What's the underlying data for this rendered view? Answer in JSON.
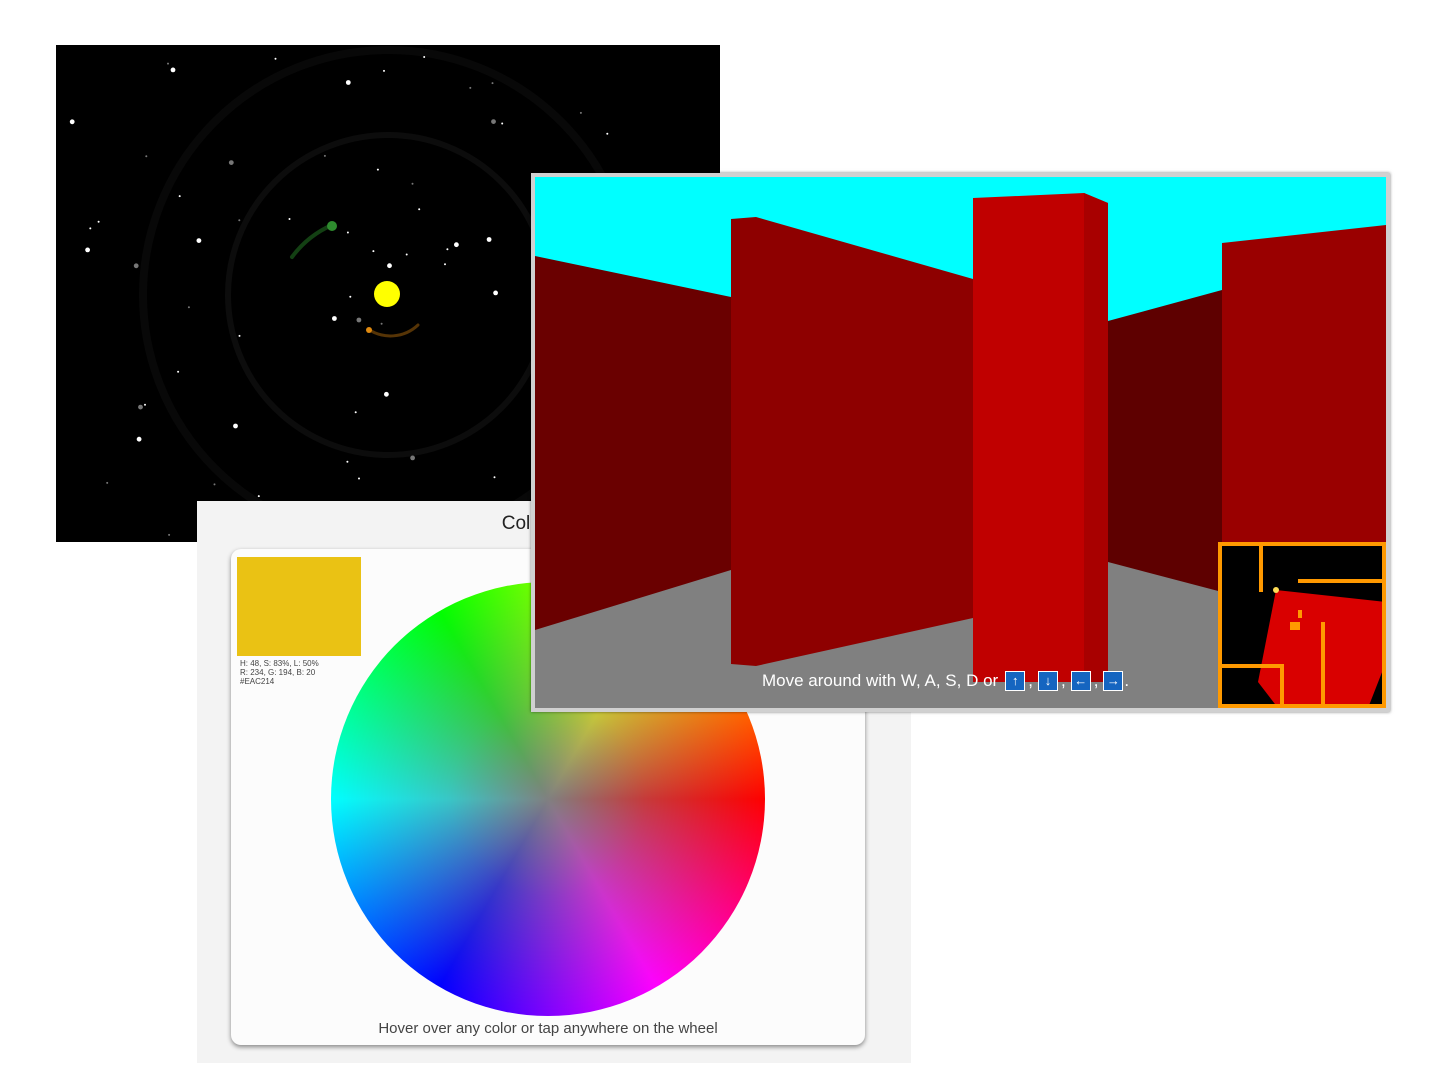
{
  "color_wheel": {
    "title": "Color Wheel",
    "hint": "Hover over any color or tap anywhere on the wheel",
    "selected": {
      "swatch_color": "#EAC214",
      "hsl": "H: 48, S: 83%, L: 50%",
      "rgb": "R: 234, G: 194, B: 20",
      "hex": "#EAC214"
    }
  },
  "maze": {
    "instructions_prefix": "Move around with W, A, S, D or",
    "keys": [
      "↑",
      "↓",
      "←",
      "→"
    ],
    "separator": ",",
    "suffix": ".",
    "colors": {
      "sky": "#00ffff",
      "floor": "#808080",
      "wall": "#c00000",
      "minimap_border": "#ff9900"
    }
  },
  "solar_system": {
    "colors": {
      "space": "#000000",
      "sun": "#ffff00",
      "planet_green": "#2e8b2e",
      "planet_orange": "#e08a10"
    }
  }
}
